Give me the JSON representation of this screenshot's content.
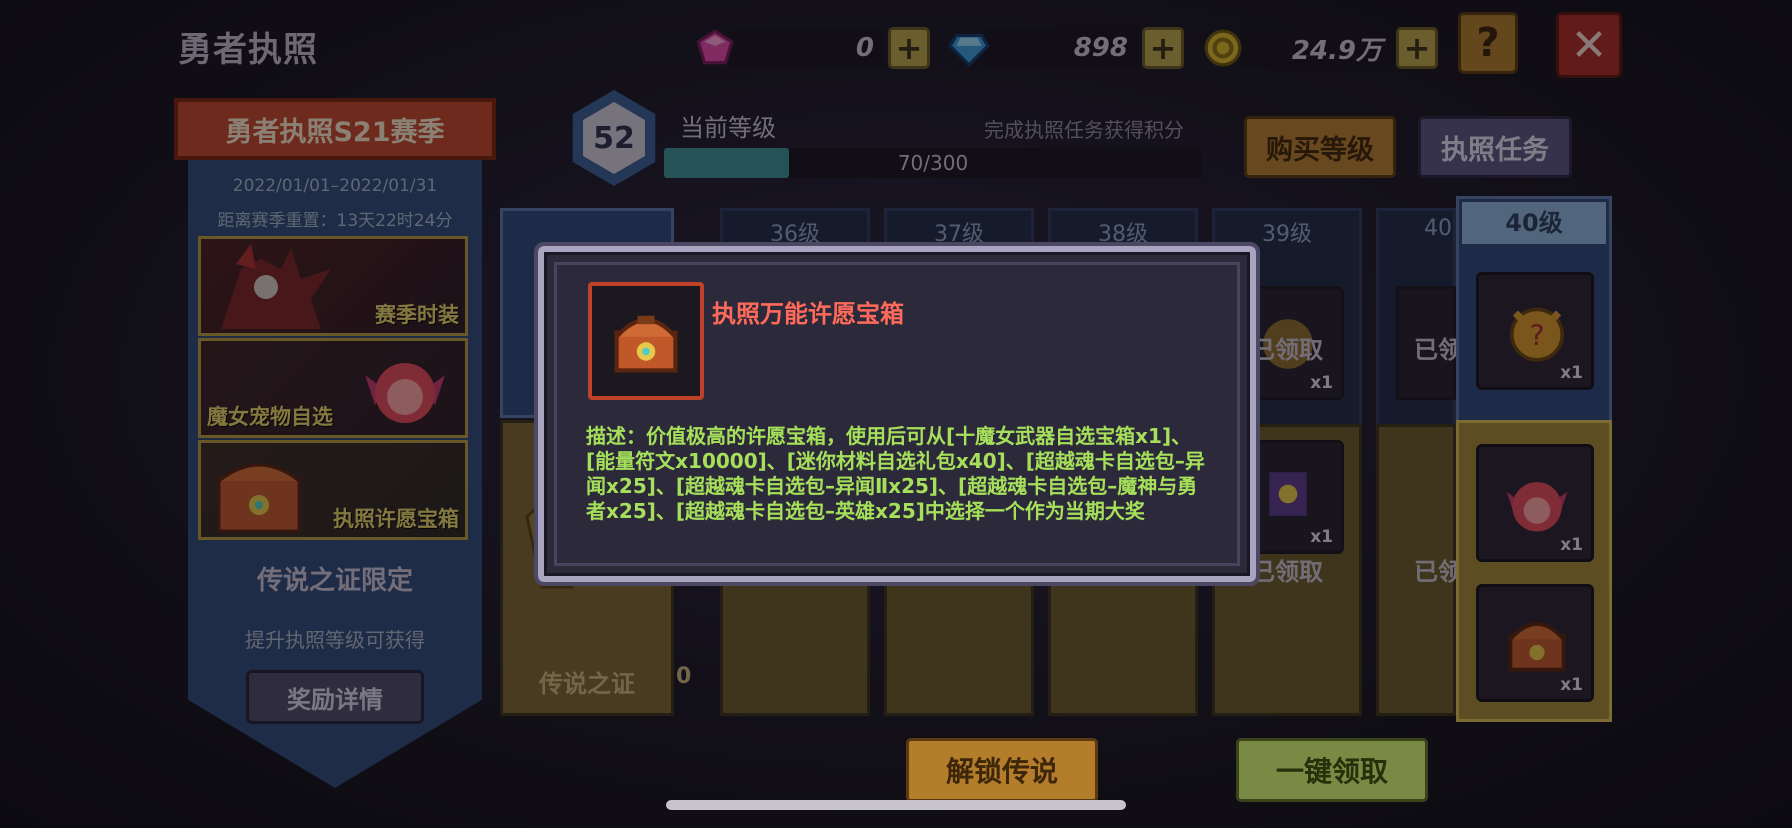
{
  "header": {
    "title": "勇者执照",
    "resources": [
      {
        "name": "pink-gem",
        "value": "0"
      },
      {
        "name": "blue-gem",
        "value": "898"
      },
      {
        "name": "gold",
        "value": "24.9万"
      }
    ],
    "help_label": "?",
    "close_label": "✕"
  },
  "left": {
    "season_title": "勇者执照S21赛季",
    "date_range": "2022/01/01–2022/01/31",
    "reset_text": "距离赛季重置：13天22时24分",
    "promos": [
      {
        "label": "赛季时装"
      },
      {
        "label": "魔女宠物自选"
      },
      {
        "label": "执照许愿宝箱"
      }
    ],
    "legend_label": "传说之证限定",
    "legend_sub": "提升执照等级可获得",
    "reward_btn": "奖励详情"
  },
  "level": {
    "current": "52",
    "label": "当前等级",
    "hint": "完成执照任务获得积分",
    "progress_text": "70/300",
    "progress_fraction": 0.233,
    "buy_btn": "购买等级",
    "task_btn": "执照任务"
  },
  "columns": {
    "heads": [
      "36级",
      "37级",
      "38级",
      "39级",
      "40"
    ],
    "claimed": "已领取",
    "claimed_partial": "已领",
    "qty": "x1",
    "col40_head": "40级",
    "legend_card": "传说之证",
    "partial_qty": "0"
  },
  "buttons": {
    "unlock": "解锁传说",
    "claim_all": "一键领取"
  },
  "modal": {
    "title": "执照万能许愿宝箱",
    "description": "描述：价值极高的许愿宝箱，使用后可从[十魔女武器自选宝箱x1]、[能量符文x10000]、[迷你材料自选礼包x40]、[超越魂卡自选包–异闻x25]、[超越魂卡自选包–异闻Ⅱx25]、[超越魂卡自选包–魔神与勇者x25]、[超越魂卡自选包–英雄x25]中选择一个作为当期大奖"
  },
  "colors": {
    "accent_gold": "#b47d2c",
    "modal_title": "#ff6a5a",
    "modal_desc": "#a6e05a",
    "season_red": "#c0452a"
  }
}
